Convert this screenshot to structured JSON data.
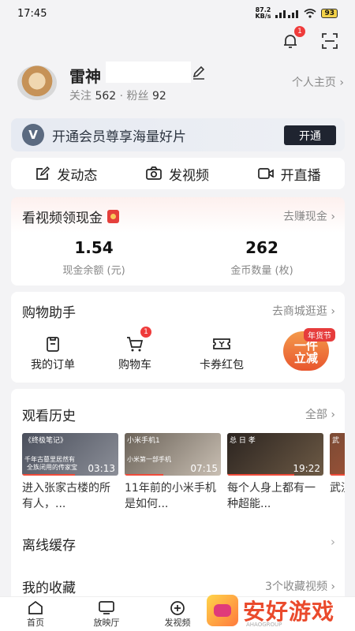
{
  "status_bar": {
    "time": "17:45",
    "net_speed_value": "87.2",
    "net_speed_unit": "KB/s",
    "battery": "93"
  },
  "header": {
    "notification_count": "1"
  },
  "profile": {
    "name": "雷神",
    "following_label": "关注",
    "following_count": "562",
    "separator": "·",
    "fans_label": "粉丝",
    "fans_count": "92",
    "homepage_link": "个人主页 ›"
  },
  "vip": {
    "logo": "V",
    "text": "开通会员尊享海量好片",
    "button": "开通"
  },
  "actions": [
    {
      "label": "发动态",
      "icon": "edit-post-icon"
    },
    {
      "label": "发视频",
      "icon": "camera-icon"
    },
    {
      "label": "开直播",
      "icon": "live-camera-icon"
    }
  ],
  "cash": {
    "title": "看视频领现金",
    "link": "去赚现金 ›",
    "balance_value": "1.54",
    "balance_label": "现金余额 (元)",
    "coins_value": "262",
    "coins_label": "金币数量 (枚)"
  },
  "shopping": {
    "title": "购物助手",
    "link": "去商城逛逛 ›",
    "items": [
      {
        "label": "我的订单",
        "icon": "order-icon"
      },
      {
        "label": "购物车",
        "icon": "cart-icon",
        "badge": "1"
      },
      {
        "label": "卡券红包",
        "icon": "coupon-icon"
      }
    ],
    "promo_text_1": "一件",
    "promo_text_2": "立减",
    "promo_tag": "年货节"
  },
  "history": {
    "title": "观看历史",
    "link": "全部 ›",
    "videos": [
      {
        "overlay": "《终极笔记》",
        "subtitle": "千年古墓里居然有",
        "subtitle2": "全族闭用的传家宝",
        "duration": "03:13",
        "title": "进入张家古楼的所有人，...",
        "progress": 0.55,
        "colors": [
          "#4a4f5c",
          "#8c8f98"
        ]
      },
      {
        "overlay": "小米手机1",
        "subtitle": "小米第一部手机",
        "subtitle2": "",
        "duration": "07:15",
        "title": "11年前的小米手机是如何...",
        "progress": 0.4,
        "colors": [
          "#6a6258",
          "#c9bfb3"
        ]
      },
      {
        "overlay": "总 日 孝",
        "subtitle": "",
        "subtitle2": "",
        "duration": "19:22",
        "title": "每个人身上都有一种超能...",
        "progress": 0.7,
        "colors": [
          "#2b2420",
          "#6d5a45"
        ]
      },
      {
        "overlay": "武",
        "subtitle": "",
        "subtitle2": "",
        "duration": "",
        "title": "武汉中国",
        "progress": 0.3,
        "colors": [
          "#7a4a34",
          "#c05a3a"
        ]
      }
    ]
  },
  "offline": {
    "title": "离线缓存",
    "chevron": "›"
  },
  "favorites": {
    "title": "我的收藏",
    "link": "3个收藏视频 ›"
  },
  "tabs": [
    {
      "label": "首页",
      "icon": "home-icon"
    },
    {
      "label": "放映厅",
      "icon": "tv-icon"
    },
    {
      "label": "发视频",
      "icon": "add-video-icon"
    }
  ],
  "watermark": {
    "text": "安好游戏",
    "sub": "AHAOGROUP"
  }
}
